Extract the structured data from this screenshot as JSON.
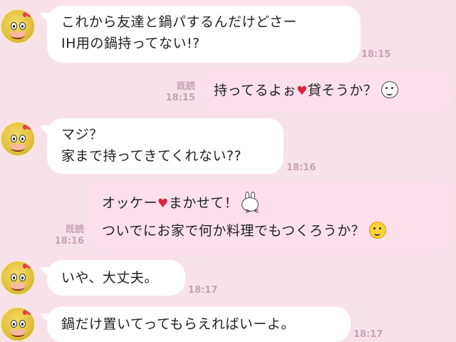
{
  "messages": [
    {
      "sender": "them",
      "lines": [
        "これから友達と鍋パするんだけどさー",
        "IH用の鍋持ってない!?"
      ],
      "time": "18:15"
    },
    {
      "sender": "me",
      "read_label": "既読",
      "time": "18:15",
      "parts": [
        "持ってるよぉ",
        "貸そうか？"
      ],
      "heart": "♥",
      "icon": "smiling-face-icon"
    },
    {
      "sender": "them",
      "lines": [
        "マジ？",
        "家まで持ってきてくれない??"
      ],
      "time": "18:16"
    },
    {
      "sender": "me",
      "read_label": "既読",
      "time": "18:16",
      "line1_parts": [
        "オッケー",
        "まかせて！"
      ],
      "line2": "ついでにお家で何か料理でもつくろうか？",
      "heart": "♥",
      "icons": [
        "bunny-sticker-icon",
        "smiling-face-icon"
      ]
    },
    {
      "sender": "them",
      "lines": [
        "いや、大丈夫。"
      ],
      "time": "18:17"
    },
    {
      "sender": "them",
      "lines": [
        "鍋だけ置いてってもらえればいーよ。"
      ],
      "time": "18:17"
    }
  ],
  "colors": {
    "background": "#f9e1ea",
    "incoming_bubble": "#ffffff",
    "outgoing_bubble": "#fde0ec",
    "timestamp": "#c9a3b1",
    "heart": "#e0223c"
  }
}
